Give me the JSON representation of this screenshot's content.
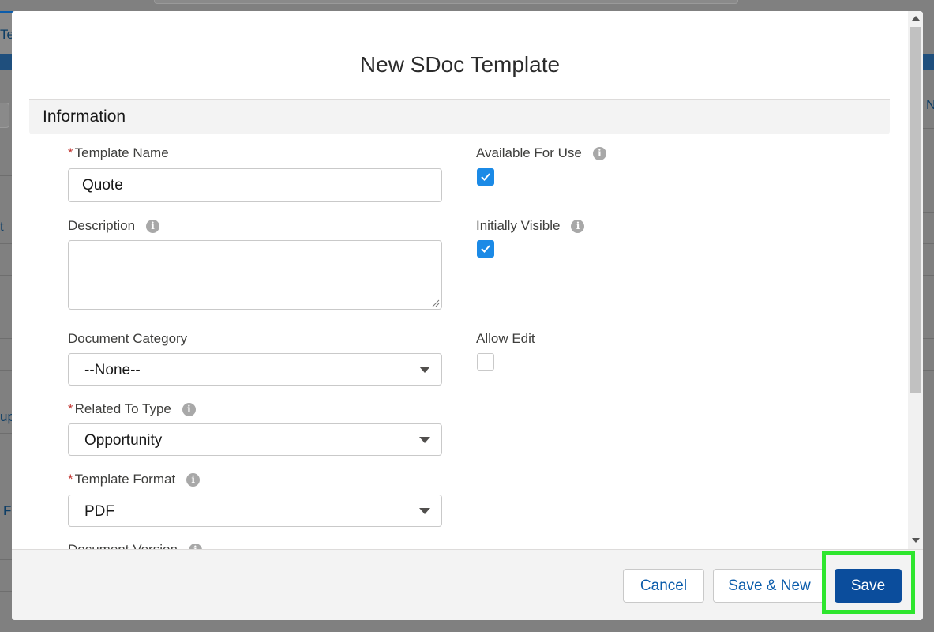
{
  "background": {
    "fragments": [
      "Te",
      "t",
      "up",
      "Fo",
      "N"
    ]
  },
  "modal": {
    "title": "New SDoc Template",
    "section": "Information",
    "fields": {
      "template_name": {
        "label": "Template Name",
        "value": "Quote",
        "required": true
      },
      "description": {
        "label": "Description",
        "value": ""
      },
      "document_category": {
        "label": "Document Category",
        "value": "--None--"
      },
      "related_to_type": {
        "label": "Related To Type",
        "value": "Opportunity",
        "required": true
      },
      "template_format": {
        "label": "Template Format",
        "value": "PDF",
        "required": true
      },
      "document_version": {
        "label": "Document Version"
      },
      "available_for_use": {
        "label": "Available For Use",
        "checked": true
      },
      "initially_visible": {
        "label": "Initially Visible",
        "checked": true
      },
      "allow_edit": {
        "label": "Allow Edit",
        "checked": false
      }
    },
    "info_glyph": "i",
    "required_marker": "*"
  },
  "footer": {
    "cancel": "Cancel",
    "save_new": "Save & New",
    "save": "Save"
  },
  "colors": {
    "brand_button": "#0b4d9c",
    "checkbox_checked": "#1b8ae6",
    "highlight": "#2ee62e",
    "required": "#c23934"
  }
}
